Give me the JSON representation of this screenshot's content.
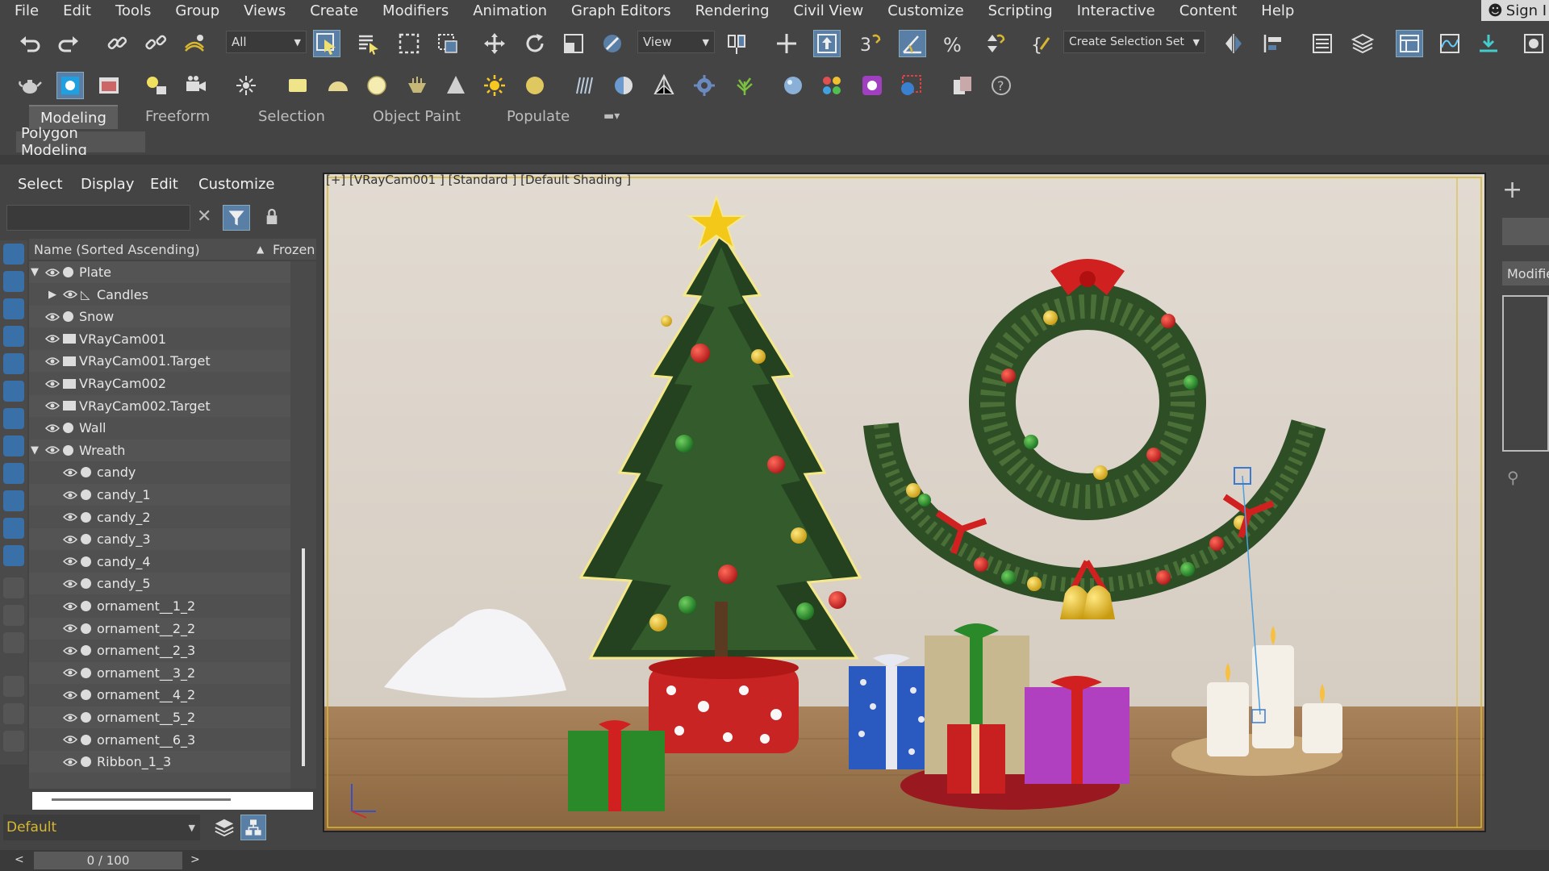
{
  "menu": [
    "File",
    "Edit",
    "Tools",
    "Group",
    "Views",
    "Create",
    "Modifiers",
    "Animation",
    "Graph Editors",
    "Rendering",
    "Civil View",
    "Customize",
    "Scripting",
    "Interactive",
    "Content",
    "Help"
  ],
  "signin": "Sign I",
  "toolbar": {
    "filter_select": "All",
    "coord_select": "View",
    "selection_set": "Create Selection Set"
  },
  "ribbon_tabs": [
    "Modeling",
    "Freeform",
    "Selection",
    "Object Paint",
    "Populate"
  ],
  "polygon_modeling": "Polygon Modeling",
  "explorer": {
    "menu": [
      "Select",
      "Display",
      "Edit",
      "Customize"
    ],
    "col_name": "Name (Sorted Ascending)",
    "col_sort_arrow": "▲",
    "col_frozen": "Frozen",
    "rows": [
      {
        "label": "Plate",
        "indent": 0,
        "expanded": true,
        "type": "geo"
      },
      {
        "label": "Candles",
        "indent": 1,
        "collapsed": true,
        "type": "shape"
      },
      {
        "label": "Snow",
        "indent": 0,
        "type": "geo"
      },
      {
        "label": "VRayCam001",
        "indent": 0,
        "type": "cam"
      },
      {
        "label": "VRayCam001.Target",
        "indent": 0,
        "type": "cam"
      },
      {
        "label": "VRayCam002",
        "indent": 0,
        "type": "cam"
      },
      {
        "label": "VRayCam002.Target",
        "indent": 0,
        "type": "cam"
      },
      {
        "label": "Wall",
        "indent": 0,
        "type": "geo"
      },
      {
        "label": "Wreath",
        "indent": 0,
        "expanded": true,
        "type": "geo"
      },
      {
        "label": "candy",
        "indent": 1,
        "type": "geo"
      },
      {
        "label": "candy_1",
        "indent": 1,
        "type": "geo"
      },
      {
        "label": "candy_2",
        "indent": 1,
        "type": "geo"
      },
      {
        "label": "candy_3",
        "indent": 1,
        "type": "geo"
      },
      {
        "label": "candy_4",
        "indent": 1,
        "type": "geo"
      },
      {
        "label": "candy_5",
        "indent": 1,
        "type": "geo"
      },
      {
        "label": "ornament__1_2",
        "indent": 1,
        "type": "geo"
      },
      {
        "label": "ornament__2_2",
        "indent": 1,
        "type": "geo"
      },
      {
        "label": "ornament__2_3",
        "indent": 1,
        "type": "geo"
      },
      {
        "label": "ornament__3_2",
        "indent": 1,
        "type": "geo"
      },
      {
        "label": "ornament__4_2",
        "indent": 1,
        "type": "geo"
      },
      {
        "label": "ornament__5_2",
        "indent": 1,
        "type": "geo"
      },
      {
        "label": "ornament__6_3",
        "indent": 1,
        "type": "geo"
      },
      {
        "label": "Ribbon_1_3",
        "indent": 1,
        "type": "geo"
      }
    ]
  },
  "layer": "Default",
  "time": "0 / 100",
  "viewport_label": "[+] [VRayCam001 ] [Standard ] [Default Shading ]",
  "modifier_label": "Modifie",
  "colors": {
    "accent": "#5a7fa6",
    "selection_outline": "#f5e88a",
    "viewport_frame": "#d8b830"
  }
}
